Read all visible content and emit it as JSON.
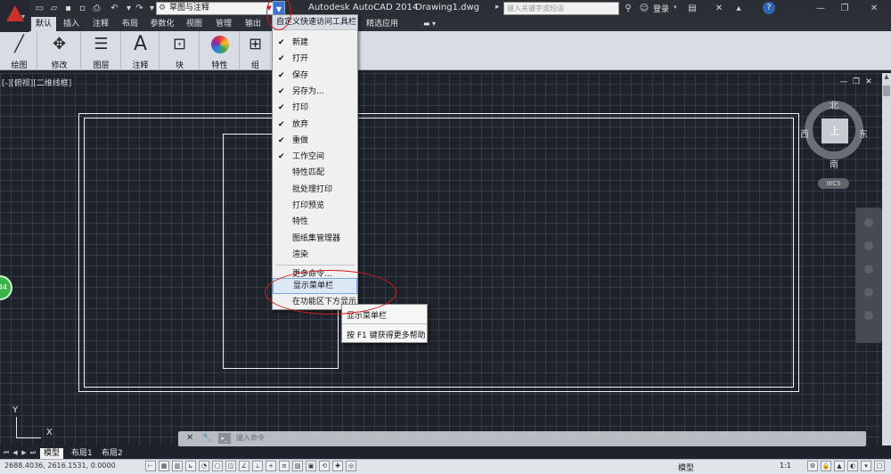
{
  "title_bar": {
    "app_title": "Autodesk AutoCAD 2014",
    "file_name": "Drawing1.dwg",
    "workspace": "草图与注释",
    "search_placeholder": "键入关键字或短语",
    "login_label": "登录",
    "help_label": "?"
  },
  "ribbon": {
    "tabs": [
      "默认",
      "插入",
      "注释",
      "布局",
      "参数化",
      "视图",
      "管理",
      "输出",
      "精选应用"
    ],
    "panels": [
      {
        "label": "绘图",
        "icon": "line-draw-icon"
      },
      {
        "label": "修改",
        "icon": "move-arrows-icon"
      },
      {
        "label": "图层",
        "icon": "layers-icon"
      },
      {
        "label": "注释",
        "icon": "text-A-icon"
      },
      {
        "label": "块",
        "icon": "block-insert-icon"
      },
      {
        "label": "特性",
        "icon": "color-wheel-icon"
      },
      {
        "label": "组",
        "icon": "group-icon"
      }
    ]
  },
  "viewport": {
    "label": "[-][俯视][二维线框]"
  },
  "viewcube": {
    "north": "北",
    "south": "南",
    "east": "东",
    "west": "西",
    "face": "上",
    "wcs": "WCS"
  },
  "quick_access_menu": {
    "header": "自定义快速访问工具栏",
    "items": [
      {
        "label": "新建",
        "checked": true
      },
      {
        "label": "打开",
        "checked": true
      },
      {
        "label": "保存",
        "checked": true
      },
      {
        "label": "另存为...",
        "checked": true
      },
      {
        "label": "打印",
        "checked": true
      },
      {
        "label": "放弃",
        "checked": true
      },
      {
        "label": "重做",
        "checked": true
      },
      {
        "label": "工作空间",
        "checked": true
      },
      {
        "label": "特性匹配",
        "checked": false
      },
      {
        "label": "批处理打印",
        "checked": false
      },
      {
        "label": "打印预览",
        "checked": false
      },
      {
        "label": "特性",
        "checked": false
      },
      {
        "label": "图纸集管理器",
        "checked": false
      },
      {
        "label": "渲染",
        "checked": false
      }
    ],
    "more_commands": "更多命令...",
    "show_menubar": "显示菜单栏",
    "show_below_ribbon": "在功能区下方显示"
  },
  "tooltip": {
    "title": "显示菜单栏",
    "help": "按 F1 键获得更多帮助"
  },
  "command_line": {
    "placeholder": "键入命令"
  },
  "layout_tabs": [
    "模型",
    "布局1",
    "布局2"
  ],
  "status_bar": {
    "coordinates": "2688.4036,  2616.1531,  0.0000",
    "model_label": "模型",
    "scale": "1:1"
  },
  "green_badge": "44",
  "colors": {
    "accent_blue": "#3b74c8",
    "annotation_red": "#d01c1c",
    "canvas_bg": "#1e222b"
  }
}
